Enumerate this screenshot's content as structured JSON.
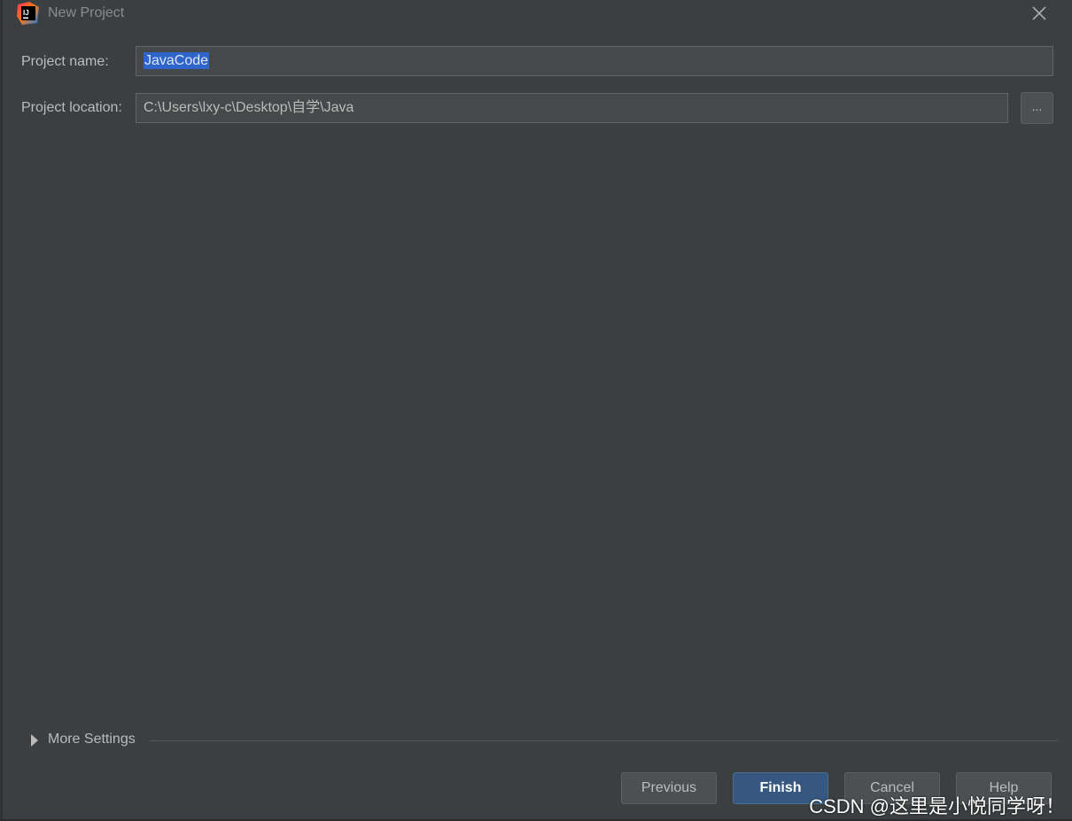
{
  "window": {
    "title": "New Project",
    "app_icon": "intellij-idea-icon",
    "app_icon_text": "IJ",
    "close_icon": "close-icon"
  },
  "form": {
    "project_name_label": "Project name:",
    "project_name_value": "JavaCode",
    "project_location_label": "Project location:",
    "project_location_value": "C:\\Users\\lxy-c\\Desktop\\自学\\Java",
    "browse_label": "..."
  },
  "more_settings": {
    "label": "More Settings",
    "expanded": false,
    "icon": "triangle-right-icon"
  },
  "buttons": {
    "previous": "Previous",
    "finish": "Finish",
    "cancel": "Cancel",
    "help": "Help"
  },
  "watermark": {
    "text": "CSDN @这里是小悦同学呀！"
  },
  "colors": {
    "background": "#3c3f41",
    "field_background": "#45494a",
    "selection": "#2f65ca",
    "primary_button": "#365880",
    "text": "#bbbbbb"
  }
}
